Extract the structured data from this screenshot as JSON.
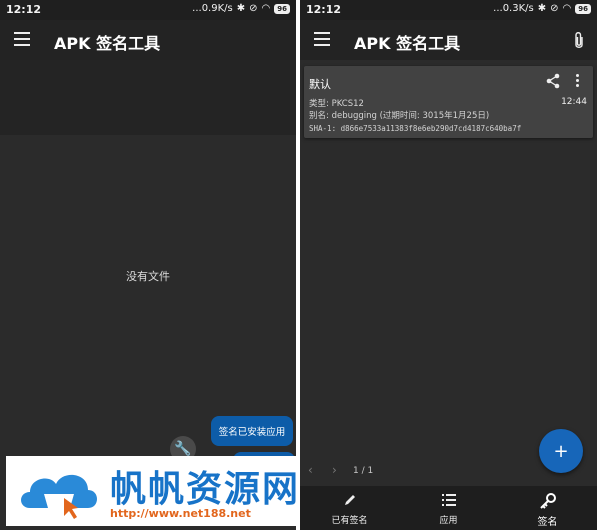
{
  "left": {
    "status": {
      "time": "12:12",
      "speed": "...0.9K/s",
      "battery": "96"
    },
    "appbar": {
      "title": "APK 签名工具"
    },
    "empty_message": "没有文件",
    "fab_menu": {
      "install_label": "签名已安装应用"
    }
  },
  "watermark": {
    "title": "帆帆资源网",
    "url": "http://www.net188.net"
  },
  "right": {
    "status": {
      "time": "12:12",
      "speed": "...0.3K/s",
      "battery": "96"
    },
    "appbar": {
      "title": "APK 签名工具"
    },
    "card": {
      "title": "默认",
      "time": "12:44",
      "type_line": "类型: PKCS12",
      "alias_line": "别名: debugging (过期时间: 3015年1月25日)",
      "sha_line": "SHA-1: d866e7533a11383f8e6eb290d7cd4187c640ba7f"
    },
    "fab_label": "+",
    "pager": {
      "label": "1 / 1"
    },
    "bottom_nav": [
      {
        "label": "已有签名",
        "icon": "pencil-icon"
      },
      {
        "label": "应用",
        "icon": "list-icon"
      },
      {
        "label": "签名",
        "icon": "key-icon"
      }
    ]
  },
  "colors": {
    "accent": "#1766b9",
    "background": "#2b2b2b",
    "card": "#424242",
    "watermark_blue": "#1773c8",
    "watermark_orange": "#e2661d"
  }
}
